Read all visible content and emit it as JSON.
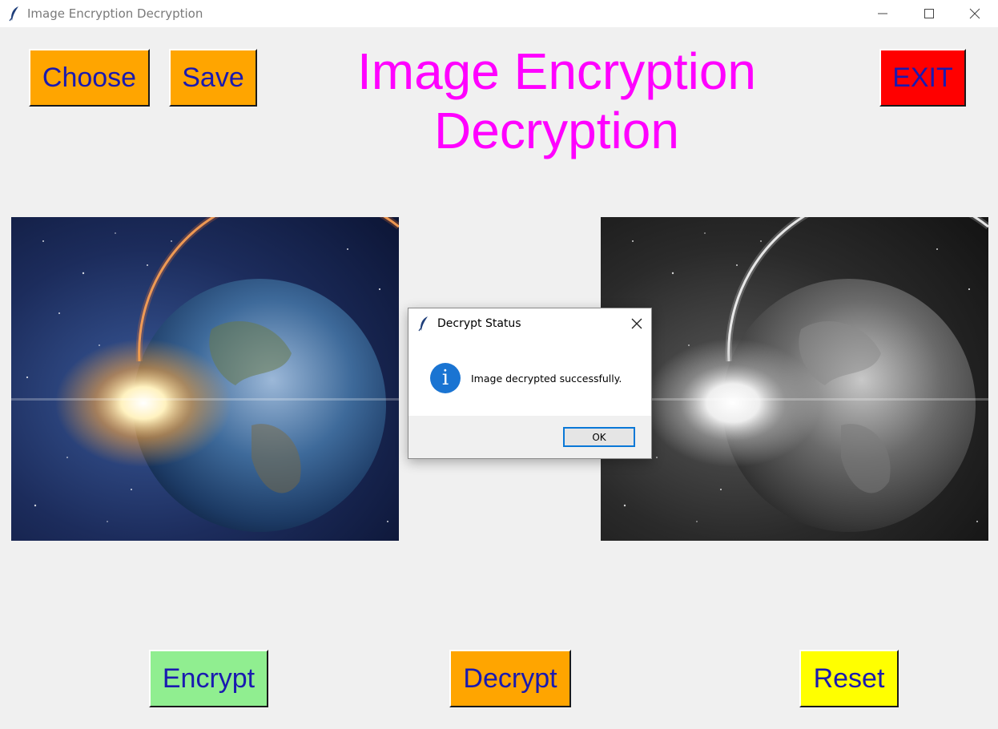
{
  "window": {
    "title": "Image Encryption Decryption",
    "controls": [
      "minimize",
      "maximize",
      "close"
    ]
  },
  "header": {
    "title_line1": "Image Encryption",
    "title_line2": "Decryption",
    "title_color": "#ff00ff"
  },
  "toolbar": {
    "choose_label": "Choose",
    "save_label": "Save",
    "exit_label": "EXIT"
  },
  "actions": {
    "encrypt_label": "Encrypt",
    "decrypt_label": "Decrypt",
    "reset_label": "Reset"
  },
  "images": {
    "left": "earth-sunrise-color",
    "right": "earth-sunrise-grayscale"
  },
  "dialog": {
    "title": "Decrypt Status",
    "message": "Image decrypted successfully.",
    "ok_label": "OK",
    "icon": "info-icon"
  },
  "colors": {
    "button_orange": "#ffa500",
    "button_green": "#90ee90",
    "button_yellow": "#ffff00",
    "button_red": "#ff0000",
    "button_text": "#1a1ab0",
    "background": "#f0f0f0"
  }
}
